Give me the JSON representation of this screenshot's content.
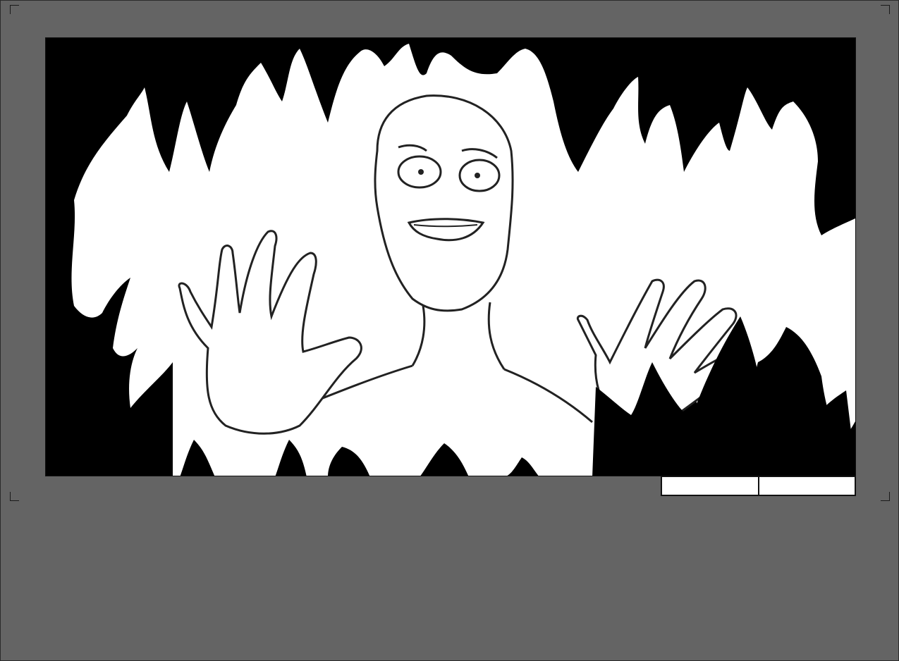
{
  "canvas": {
    "background_color": "#646464",
    "panel_background_color": "#000000",
    "sketch_fill_color": "#ffffff",
    "line_color": "#222222"
  },
  "panel": {
    "subject": "sketch-figure-with-raised-hands-in-flames"
  },
  "slot_strip": {
    "slots": [
      "",
      ""
    ]
  },
  "icons": {
    "crop_marks": [
      "crop-mark-top-left",
      "crop-mark-top-right",
      "crop-mark-bottom-left",
      "crop-mark-bottom-right"
    ]
  }
}
